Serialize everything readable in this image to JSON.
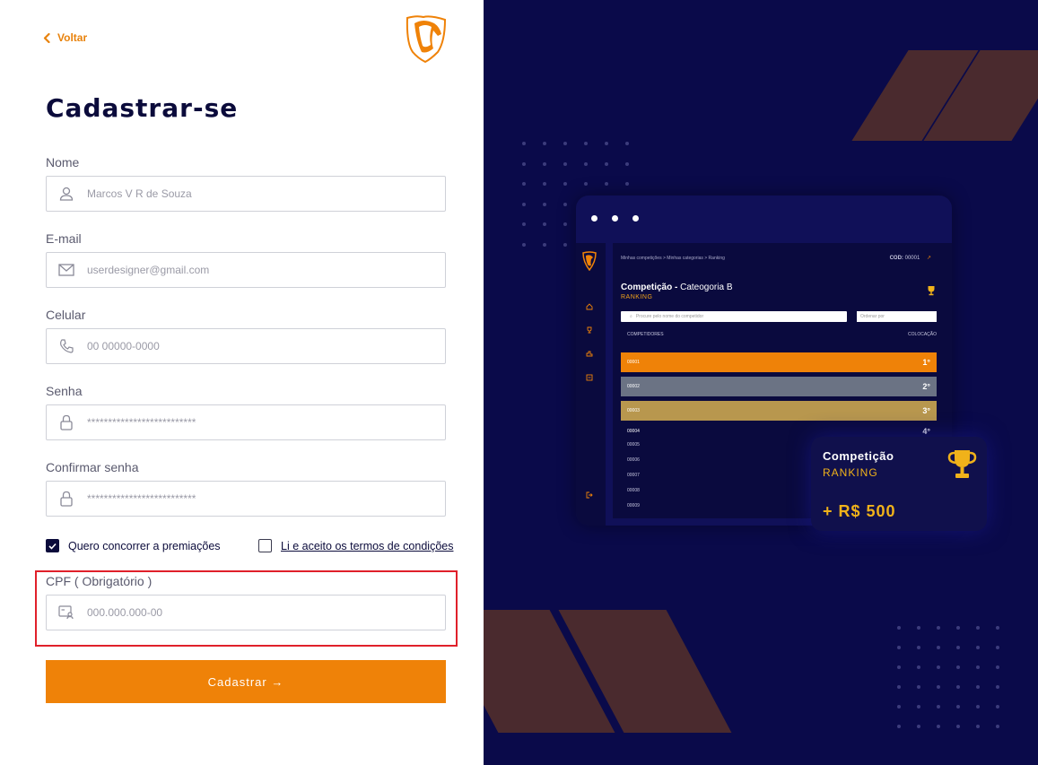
{
  "nav": {
    "back_label": "Voltar"
  },
  "page": {
    "title": "Cadastrar-se"
  },
  "form": {
    "name": {
      "label": "Nome",
      "placeholder": "Marcos V R de Souza"
    },
    "email": {
      "label": "E-mail",
      "placeholder": "userdesigner@gmail.com"
    },
    "phone": {
      "label": "Celular",
      "placeholder": "00 00000-0000"
    },
    "password": {
      "label": "Senha",
      "placeholder": "**************************"
    },
    "confirm": {
      "label": "Confirmar senha",
      "placeholder": "**************************"
    },
    "prizes_checkbox": {
      "label": "Quero concorrer a premiações",
      "checked": true
    },
    "terms_checkbox": {
      "label": "Li e aceito os termos de condições",
      "checked": false
    },
    "cpf": {
      "label": "CPF ( Obrigatório )",
      "placeholder": "000.000.000-00"
    },
    "submit_label": "Cadastrar →"
  },
  "preview": {
    "breadcrumb": "Minhas competições  >  Minhas categorias  >  Ranking",
    "cod_label": "COD:",
    "cod_value": "00001",
    "title_bold": "Competição -",
    "title_rest": " Cateogoria B",
    "subtitle": "RANKING",
    "search_placeholder": "Procure pelo nome do competidor",
    "sort_placeholder": "Ordenar por",
    "col_left": "COMPETIDORES",
    "col_right": "COLOCAÇÃO",
    "top_rows": [
      {
        "id": "00001",
        "pos": "1°",
        "color": "#ef8208"
      },
      {
        "id": "00002",
        "pos": "2°",
        "color": "#6b7384"
      },
      {
        "id": "00003",
        "pos": "3°",
        "color": "#b8974e"
      }
    ],
    "row4": {
      "id": "00004",
      "pos": "4°"
    },
    "other_rows": [
      "00005",
      "00006",
      "00007",
      "00008",
      "00009"
    ]
  },
  "card": {
    "title": "Competição",
    "subtitle": "RANKING",
    "amount": "+ R$ 500"
  },
  "colors": {
    "accent": "#ef8208",
    "navy": "#0b0b3b",
    "panel": "#0a0a4a",
    "highlight": "#e0202a"
  }
}
